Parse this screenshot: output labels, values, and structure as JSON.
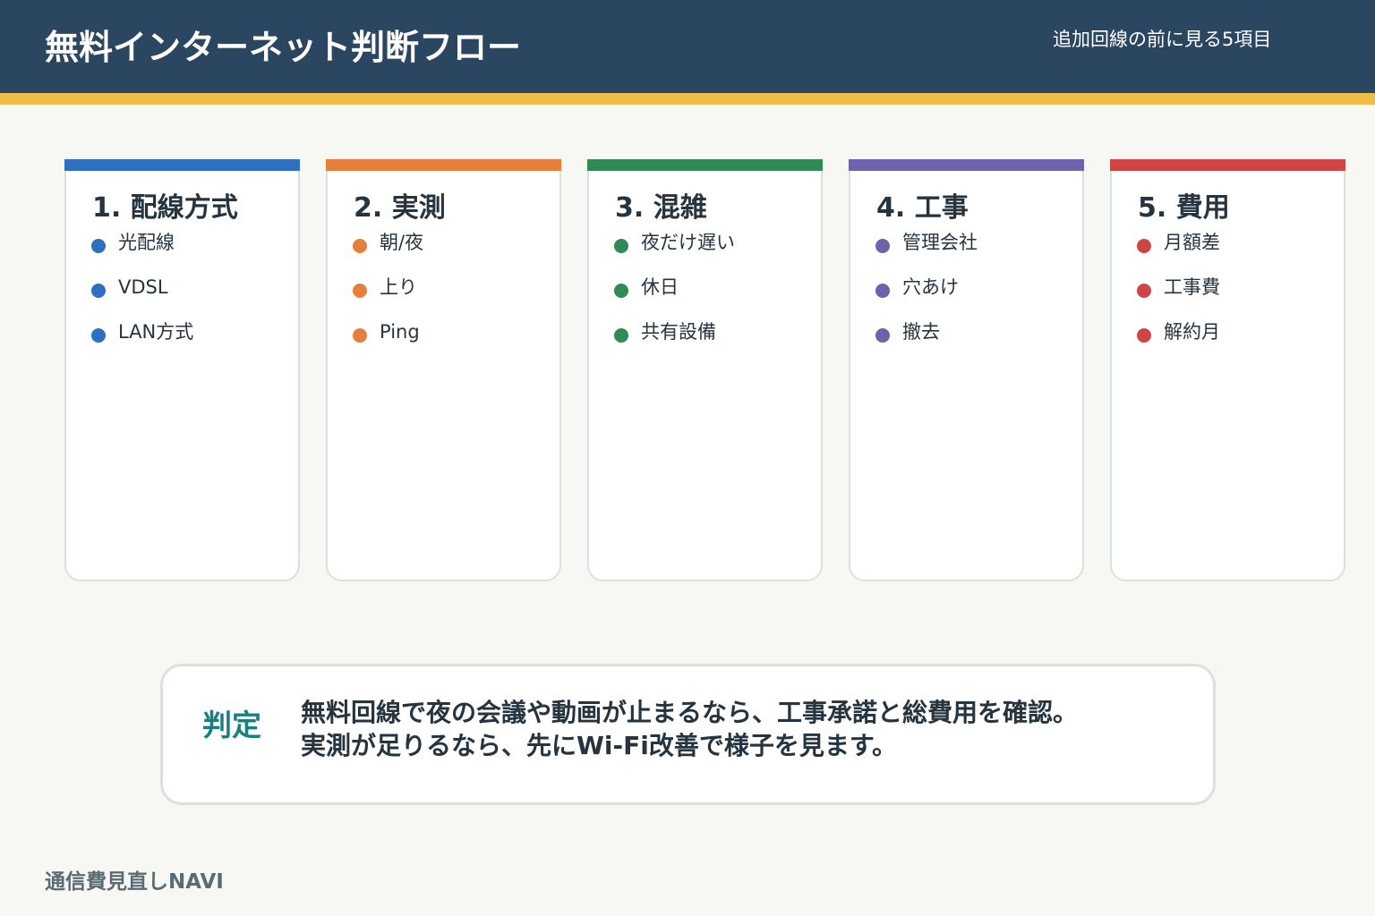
{
  "header": {
    "title": "無料インターネット判断フロー",
    "subtitle": "追加回線の前に見る5項目"
  },
  "cards": [
    {
      "title": "1. 配線方式",
      "color": "#2f6fc0",
      "items": [
        "光配線",
        "VDSL",
        "LAN方式"
      ]
    },
    {
      "title": "2. 実測",
      "color": "#e77f3c",
      "items": [
        "朝/夜",
        "上り",
        "Ping"
      ]
    },
    {
      "title": "3. 混雑",
      "color": "#2f8a55",
      "items": [
        "夜だけ遅い",
        "休日",
        "共有設備"
      ]
    },
    {
      "title": "4. 工事",
      "color": "#7061ab",
      "items": [
        "管理会社",
        "穴あけ",
        "撤去"
      ]
    },
    {
      "title": "5. 費用",
      "color": "#cf4544",
      "items": [
        "月額差",
        "工事費",
        "解約月"
      ]
    }
  ],
  "verdict": {
    "label": "判定",
    "lines": [
      "無料回線で夜の会議や動画が止まるなら、工事承諾と総費用を確認。",
      "実測が足りるなら、先にWi-Fi改善で様子を見ます。"
    ]
  },
  "footer": {
    "brand": "通信費見直しNAVI"
  }
}
